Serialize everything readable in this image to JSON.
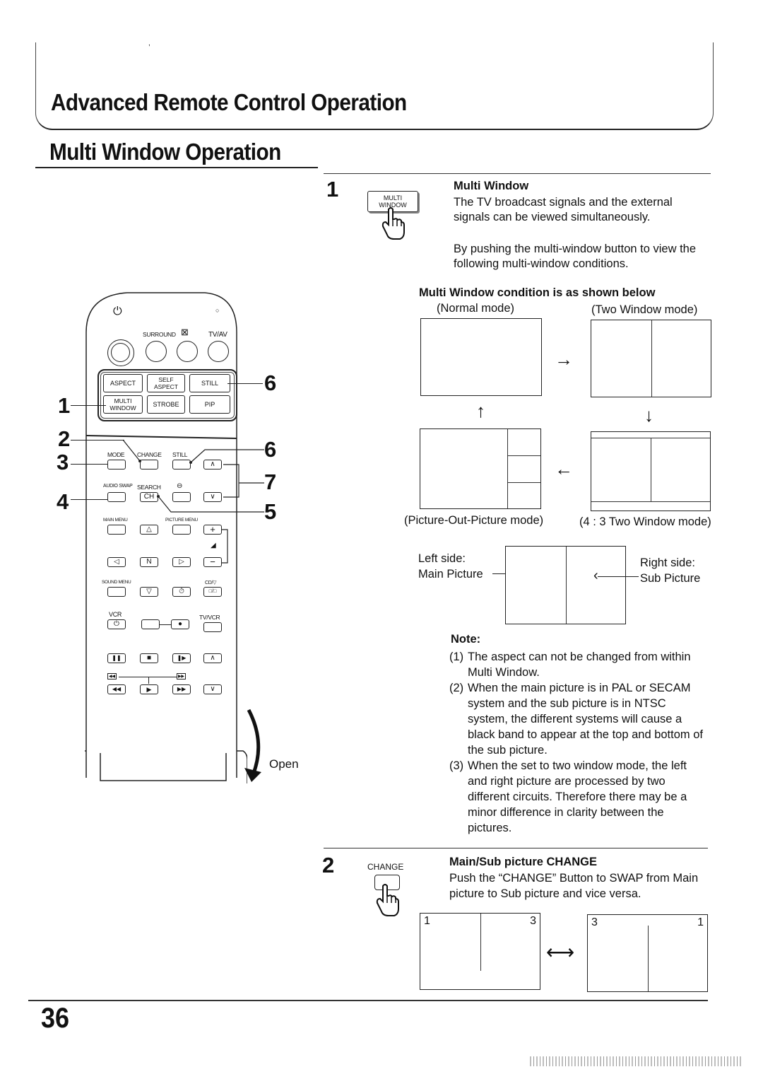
{
  "header": {
    "chapter_title": "Advanced Remote Control Operation",
    "section_title": "Multi Window Operation"
  },
  "step1": {
    "number": "1",
    "button_icon": "multi-window-button-press-icon",
    "button_label_line1": "MULTI",
    "button_label_line2": "WINDOW",
    "heading": "Multi Window",
    "text1": "The TV broadcast signals and the external signals can be viewed simultaneously.",
    "text2": "By pushing the multi-window button to view the following multi-window conditions.",
    "conditions_heading": "Multi Window condition is as shown below",
    "modes": {
      "normal": "(Normal mode)",
      "two_window": "(Two Window mode)",
      "pop": "(Picture-Out-Picture mode)",
      "four_three": "(4 : 3 Two Window mode)"
    },
    "arrows": {
      "normal_to_two": "→",
      "two_to_43": "↓",
      "43_to_pop": "←",
      "pop_to_normal": "↑"
    },
    "split_diagram": {
      "left_label_line1": "Left side:",
      "left_label_line2": "Main Picture",
      "right_label_line1": "Right side:",
      "right_label_line2": "Sub Picture"
    }
  },
  "note": {
    "heading": "Note:",
    "items": [
      {
        "num": "(1)",
        "text": "The aspect can not be changed from within Multi Window."
      },
      {
        "num": "(2)",
        "text": "When the main picture is in PAL or SECAM system and the sub picture is in NTSC system, the different systems will cause a black band to appear at the top and bottom of the sub picture."
      },
      {
        "num": "(3)",
        "text": "When the set to two window mode, the left and right picture are processed by two different circuits. Therefore there may be a minor difference in clarity between the pictures."
      }
    ]
  },
  "step2": {
    "number": "2",
    "button_label": "CHANGE",
    "heading": "Main/Sub picture CHANGE",
    "text": "Push the “CHANGE” Button to SWAP from Main picture to Sub picture and vice versa.",
    "swap_arrow": "⟷",
    "before": {
      "left": "1",
      "right": "3"
    },
    "after": {
      "left": "3",
      "right": "1"
    }
  },
  "remote": {
    "top_labels": {
      "power": "⏻",
      "surround": "SURROUND",
      "mute": "🔇",
      "tv_av": "TV/AV"
    },
    "function_buttons": [
      "ASPECT",
      "SELF ASPECT",
      "STILL",
      "MULTI WINDOW",
      "STROBE",
      "PIP"
    ],
    "row_labels": {
      "mode": "MODE",
      "change": "CHANGE",
      "still": "STILL",
      "audio_swap": "AUDIO SWAP",
      "search": "SEARCH",
      "timer": "⊖",
      "main_menu": "MAIN MENU",
      "picture_menu": "PICTURE MENU",
      "sound_menu": "SOUND MENU",
      "cd_v": "CD/▽",
      "vcr": "VCR",
      "tv_vcr": "TV/VCR"
    },
    "button_glyphs": {
      "ch_up": "∧",
      "ch_down": "∨",
      "search_ch": "CH",
      "up": "△",
      "down": "▽",
      "left": "◁",
      "right": "▷",
      "n": "N",
      "vol_plus": "+",
      "vol_minus": "−",
      "vol_icon": "◢",
      "timer": "⏱",
      "text": "□/□",
      "vcr_power": "⏻",
      "rec": "●",
      "pause": "❚❚",
      "stop": "■",
      "slow": "❚▶",
      "vcr_ch_up": "∧",
      "rew": "◀◀",
      "play": "▶",
      "ff": "▶▶",
      "vcr_ch_down": "∨",
      "rew_small": "◀◀",
      "ff_small": "▶▶"
    },
    "callouts": [
      "1",
      "2",
      "3",
      "4",
      "5",
      "6",
      "6",
      "7"
    ],
    "open_label": "Open"
  },
  "footer": {
    "page_number": "36"
  }
}
